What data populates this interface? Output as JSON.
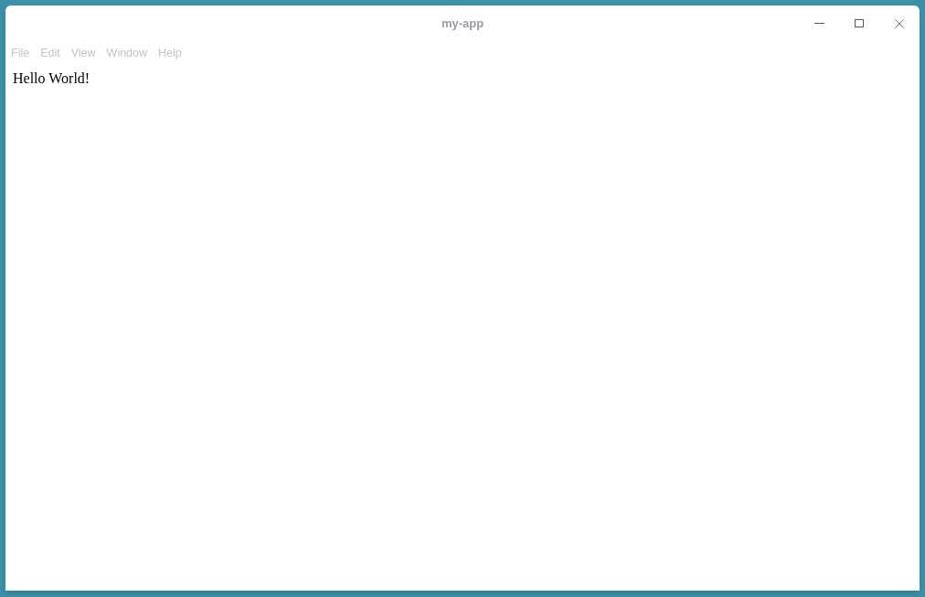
{
  "window": {
    "title": "my-app"
  },
  "menu": [
    "File",
    "Edit",
    "View",
    "Window",
    "Help"
  ],
  "content": {
    "text": "Hello World!"
  }
}
